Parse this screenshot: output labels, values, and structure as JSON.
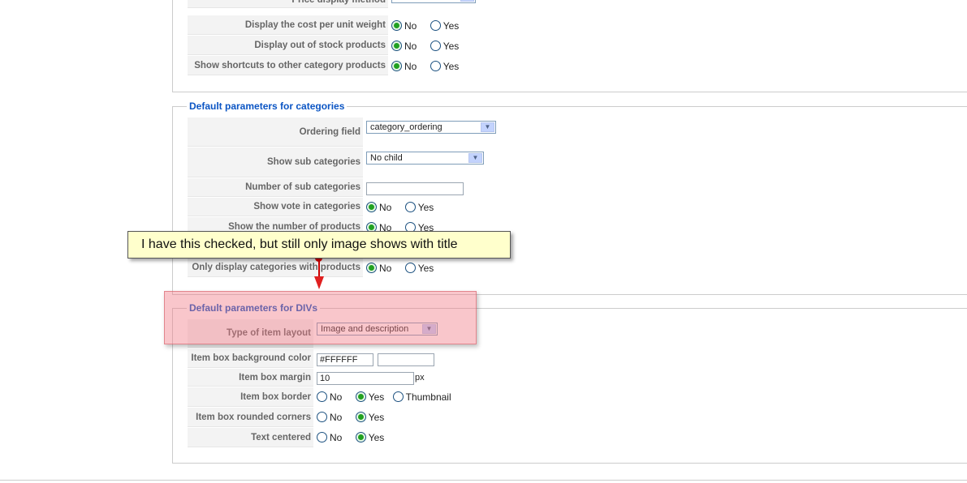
{
  "colors": {
    "legend": "#0b55c4",
    "label_bg": "#f3f3f3",
    "callout_bg": "#ffffcc",
    "highlight": "#f07882",
    "radio_checked": "#21a121"
  },
  "top_section": {
    "partial_label": "Price display method",
    "rows": [
      {
        "label": "Display the cost per unit weight",
        "no": "No",
        "yes": "Yes",
        "selected": "No"
      },
      {
        "label": "Display out of stock products",
        "no": "No",
        "yes": "Yes",
        "selected": "No"
      },
      {
        "label": "Show shortcuts to other category products",
        "no": "No",
        "yes": "Yes",
        "selected": "No"
      }
    ]
  },
  "categories_section": {
    "legend": "Default parameters for categories",
    "ordering_field": {
      "label": "Ordering field",
      "value": "category_ordering"
    },
    "show_sub_categories": {
      "label": "Show sub categories",
      "value": "No child"
    },
    "number_sub_categories": {
      "label": "Number of sub categories",
      "value": ""
    },
    "show_vote": {
      "label": "Show vote in categories",
      "no": "No",
      "yes": "Yes",
      "selected": "No"
    },
    "show_number_products": {
      "label": "Show the number of products",
      "no": "No",
      "yes": "Yes",
      "selected": "No"
    },
    "only_display": {
      "label": "Only display categories with products",
      "no": "No",
      "yes": "Yes",
      "selected": "No"
    }
  },
  "divs_section": {
    "legend": "Default parameters for DIVs",
    "item_layout": {
      "label": "Type of item layout",
      "value": "Image and description"
    },
    "bg_color": {
      "label": "Item box background color",
      "value": "#FFFFFF",
      "value2": ""
    },
    "margin": {
      "label": "Item box margin",
      "value": "10",
      "unit": "px"
    },
    "border": {
      "label": "Item box border",
      "no": "No",
      "yes": "Yes",
      "thumb": "Thumbnail",
      "selected": "Yes"
    },
    "rounded": {
      "label": "Item box rounded corners",
      "no": "No",
      "yes": "Yes",
      "selected": "Yes"
    },
    "centered": {
      "label": "Text centered",
      "no": "No",
      "yes": "Yes",
      "selected": "Yes"
    }
  },
  "annotation": {
    "text": "I have this checked, but still only image shows with title"
  }
}
